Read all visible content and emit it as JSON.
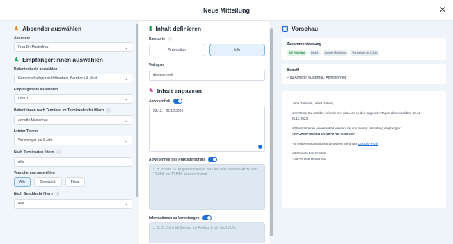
{
  "dialog": {
    "title": "Neue Mitteilung",
    "close_icon": "close-icon"
  },
  "absender": {
    "heading": "Absender auswählen",
    "icon": "person-icon",
    "label": "Absender",
    "value": "Frau Dr. Musterfrau"
  },
  "empfaenger": {
    "heading": "Empfänger:innen auswählen",
    "icon": "people-icon",
    "patientenbasis_label": "Patientenbasis auswählen",
    "patientenbasis_value": "Gemeinschaftspraxis Höhenbein, Bernbach & Must...",
    "liste_label": "Empfängerliste auswählen",
    "liste_value": "Liste 1",
    "termine_label": "Patient:innen nach Terminen im Terminkalender filtern",
    "termine_value": "Annette Musterfrau",
    "letzter_label": "Letzter Termin",
    "letzter_value": "Vor weniger als 1 Jahr",
    "terminarten_label": "Nach Terminarten filtern",
    "terminarten_value": "Alle",
    "versicherung_label": "Versicherung auswählen",
    "versicherung_options": [
      "Alle",
      "Gesetzlich",
      "Privat"
    ],
    "geschlecht_label": "Nach Geschlecht filtern",
    "geschlecht_value": "Alle"
  },
  "inhalt": {
    "heading": "Inhalt definieren",
    "icon": "document-icon",
    "kategorie_label": "Kategorie",
    "kategorie_options": [
      "Prävention",
      "Info"
    ],
    "vorlagen_label": "Vorlagen",
    "vorlagen_value": "Abwesenheit"
  },
  "anpassen": {
    "heading": "Inhalt anpassen",
    "icon": "pencil-icon",
    "abwesenheit_label": "Abwesenheit",
    "abwesenheit_value": "23.12. - 26.12.2025",
    "praxis_label": "Abwesenheit des Praxispersonals",
    "praxis_placeholder": "z. B. ich am 15. August abwesend bin / am oder mehrere Ärzte vom TT.MM. bis TT.MM. abwesend sind",
    "vertretung_label": "Informationen zu Vertretungen",
    "vertretung_placeholder": "z. B. Dr. Schmidt Montag bis Freitag, 8 Uhr bis 10 Uhr"
  },
  "vorschau": {
    "heading": "Vorschau",
    "zusammenfassung_title": "Zusammenfassung",
    "chips": [
      "812 Patienten",
      "Liste 1",
      "Annette Musterfrau",
      "Vor weniger als 1 Jahr"
    ],
    "betreff_title": "Betreff",
    "betreff_value": "Frau Annette Musterfrau: Abwesenheit",
    "message": {
      "greeting": "Liebe Patientin, lieber Patient,",
      "line1": "ich möchte Sie darüber informieren, dass ich an den folgenden Tagen abwesend bin: 23.12. - 26.12.2023",
      "line2": "Während meiner Abwesenheit werden Sie von meiner Vertretung empfangen:",
      "line2b": "<INFORMATIONEN ZU VERTRETUNGEN>",
      "line3": "Für weitere Informationen besuchen Sie unser",
      "link": "Doctolib-Profil",
      "closing": "Mit freundlichen Grüßen,",
      "signature": "Frau Annette Musterfrau"
    }
  },
  "colors": {
    "accent": "#1d6fd6",
    "panel_left": "#f1f6fb",
    "panel_right": "#eef4fa",
    "orange": "#f08a24",
    "green": "#1fa35c",
    "pink": "#e0338a"
  }
}
